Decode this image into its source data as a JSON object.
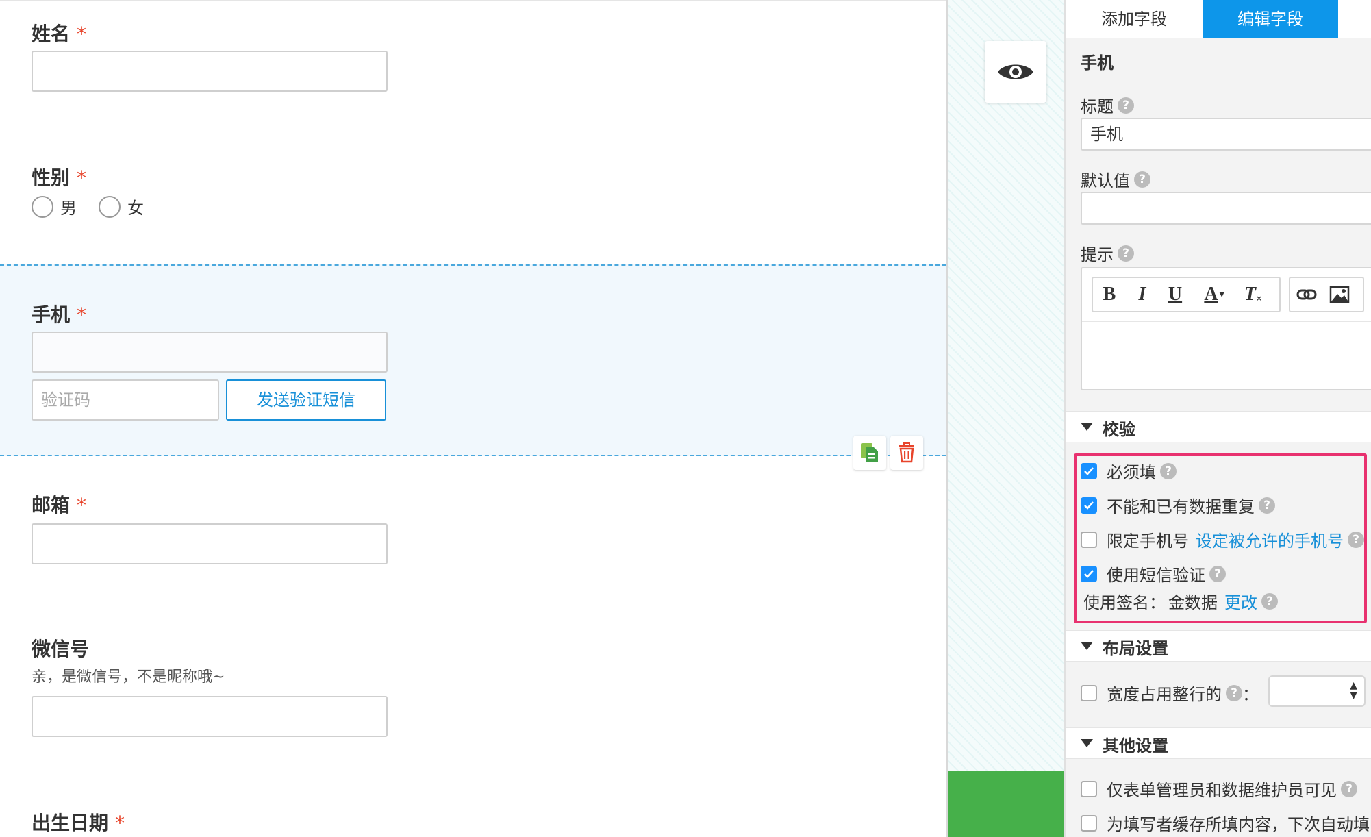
{
  "form": {
    "fields": {
      "name": {
        "label": "姓名",
        "required": "*"
      },
      "gender": {
        "label": "性别",
        "required": "*",
        "options": [
          "男",
          "女"
        ]
      },
      "phone": {
        "label": "手机",
        "required": "*",
        "code_placeholder": "验证码",
        "sms_button": "发送验证短信"
      },
      "email": {
        "label": "邮箱",
        "required": "*"
      },
      "wechat": {
        "label": "微信号",
        "description": "亲，是微信号，不是昵称哦~"
      },
      "birthday": {
        "label": "出生日期",
        "required": "*"
      }
    }
  },
  "panel": {
    "tabs": {
      "add": "添加字段",
      "edit": "编辑字段"
    },
    "field_type": "手机",
    "title_label": "标题",
    "title_value": "手机",
    "default_label": "默认值",
    "hint_label": "提示",
    "toolbar": {
      "bold": "B",
      "italic": "I",
      "underline": "U",
      "color": "A",
      "clear": "T"
    },
    "sections": {
      "validation": {
        "title": "校验",
        "required": "必须填",
        "unique": "不能和已有数据重复",
        "limit_phone": "限定手机号",
        "limit_phone_link": "设定被允许的手机号",
        "sms_verify": "使用短信验证",
        "signature_label": "使用签名：",
        "signature_value": "金数据",
        "signature_change": "更改"
      },
      "layout": {
        "title": "布局设置",
        "full_width": "宽度占用整行的",
        "colon": "："
      },
      "other": {
        "title": "其他设置",
        "admin_only": "仅表单管理员和数据维护员可见",
        "cache": "为填写者缓存所填内容，下次自动填"
      }
    },
    "checkbox_states": {
      "required": true,
      "unique": true,
      "limit_phone": false,
      "sms_verify": true,
      "full_width": false,
      "admin_only": false,
      "cache": false
    }
  },
  "colors": {
    "accent": "#0d96ea",
    "required": "#e8452c",
    "highlight": "#e8316f",
    "green": "#46b04a",
    "delete": "#e8452c"
  }
}
